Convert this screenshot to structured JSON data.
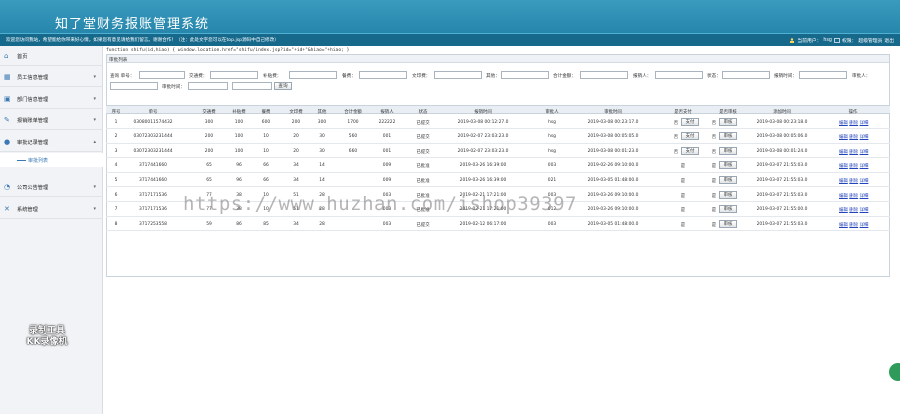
{
  "header": {
    "title": "知了堂财务报账管理系统",
    "welcome": "欢迎您访问我站，希望能给你带来好心情，如果您有意见请给我们留言。谢谢合作！（注：此处文字您可以在top.jsp源码中自己修改）",
    "current_user_label": "当前用户：",
    "current_user": "hsg",
    "permission_label": "权限：",
    "permission_value": "超级管理员",
    "logout": "退出"
  },
  "sidebar": {
    "items": [
      {
        "label": "首页",
        "icon": "home-icon"
      },
      {
        "label": "员工信息管理",
        "icon": "grid-icon"
      },
      {
        "label": "部门信息管理",
        "icon": "building-icon"
      },
      {
        "label": "报销账单管理",
        "icon": "bill-icon"
      },
      {
        "label": "审批记录管理",
        "icon": "user-icon"
      },
      {
        "label": "公司公告管理",
        "icon": "bell-icon"
      },
      {
        "label": "系统管理",
        "icon": "tools-icon"
      }
    ],
    "sub_item": "审批列表",
    "watermark_tool": [
      "录制工具",
      "KK录像机"
    ]
  },
  "code_line": "function shifu(id,hiao) { window.location.href=\"shifu/index.jsp?id=\"+id+\"&hiao=\"+hiao; }",
  "panel_title": "审批列表",
  "filters": {
    "labels": [
      "查询 单号：",
      "交通费：",
      "补贴费：",
      "餐费：",
      "文印费：",
      "其他：",
      "合计金额：",
      "报销人：",
      "状态：",
      "报销时间：",
      "审批人：",
      "审批时间："
    ],
    "query_button": "查询"
  },
  "table": {
    "headers": [
      "序号",
      "单号",
      "交通费",
      "补贴费",
      "餐费",
      "文印费",
      "其他",
      "合计金额",
      "报销人",
      "状态",
      "报销时间",
      "审批人",
      "审批时间",
      "是否支付",
      "是否审核",
      "添加时间",
      "操作"
    ],
    "rows": [
      [
        "1",
        "03080011574432",
        "300",
        "100",
        "600",
        "200",
        "300",
        "1700",
        "222222",
        "已提交",
        "2019-03-08 00:12:27.0",
        "hsg",
        "2019-03-08 00:23:17.0",
        "否",
        "审核",
        "2019-03-08 00:23:18.0"
      ],
      [
        "2",
        "03072303231444",
        "200",
        "100",
        "10",
        "20",
        "30",
        "560",
        "001",
        "已提交",
        "2019-02-07 23:03:23.0",
        "hsg",
        "2019-03-08 00:05:05.0",
        "否",
        "审核",
        "2019-03-08 00:05:06.0"
      ],
      [
        "3",
        "03072303231444",
        "200",
        "100",
        "10",
        "20",
        "30",
        "660",
        "001",
        "已提交",
        "2019-02-07 23:03:23.0",
        "hsg",
        "2019-03-08 00:01:23.0",
        "否",
        "审核",
        "2019-03-08 00:01:24.0"
      ],
      [
        "4",
        "3717441660",
        "65",
        "96",
        "66",
        "34",
        "14",
        "",
        "009",
        "已批准",
        "2019-03-26 16:39:00",
        "003",
        "2019-02-26 09:10:00.0",
        "是",
        "审核",
        "2019-03-07 21:55:03.0"
      ],
      [
        "5",
        "3717441660",
        "65",
        "96",
        "66",
        "34",
        "14",
        "",
        "009",
        "已批准",
        "2019-03-26 16:39:00",
        "021",
        "2019-03-05 01:48:00.0",
        "是",
        "审核",
        "2019-03-07 21:55:03.0"
      ],
      [
        "6",
        "3717171536",
        "77",
        "38",
        "10",
        "51",
        "28",
        "",
        "003",
        "已批准",
        "2019-02-21 17:21:00",
        "003",
        "2019-03-26 09:10:00.0",
        "是",
        "审核",
        "2019-03-07 21:55:03.0"
      ],
      [
        "7",
        "3717171536",
        "77",
        "38",
        "10",
        "51",
        "28",
        "",
        "003",
        "已批准",
        "2019-02-21 17:21:00",
        "012",
        "2019-03-26 09:10:00.0",
        "是",
        "审核",
        "2019-03-07 21:55:00.0"
      ],
      [
        "8",
        "3717253558",
        "59",
        "86",
        "85",
        "34",
        "28",
        "",
        "003",
        "已提交",
        "2019-02-12 06:17:00",
        "003",
        "2019-03-05 01:48:00.0",
        "是",
        "审核",
        "2019-03-07 21:55:03.0"
      ]
    ],
    "pay_button": "支付",
    "ops": [
      "编辑",
      "删除",
      "详细"
    ]
  },
  "watermark_url": "https://www.huzhan.com/ishop39397",
  "colors": {
    "header": "#2585ad",
    "subbar": "#17698c",
    "accent": "#3b78b5",
    "link": "#2244bb"
  }
}
